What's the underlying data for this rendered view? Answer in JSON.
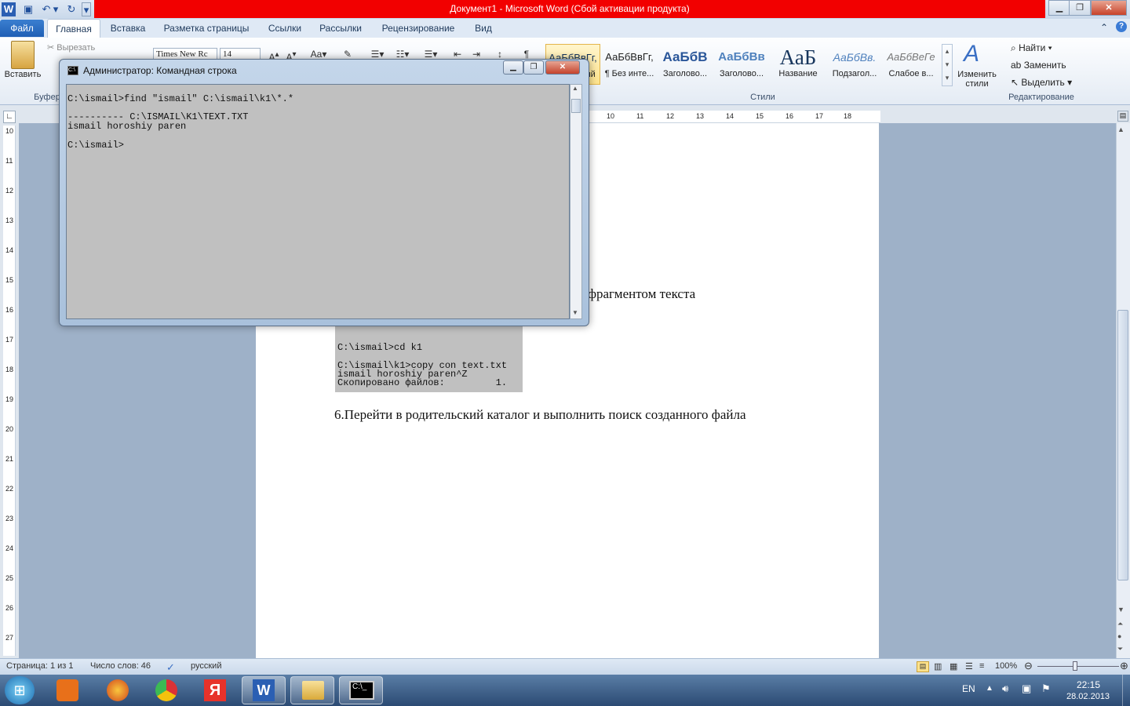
{
  "window": {
    "title": "Документ1  -  Microsoft Word (Сбой активации продукта)",
    "min": "▁",
    "max": "❐",
    "close": "✕"
  },
  "quick_access": {
    "word_icon": "W",
    "save": "▣",
    "undo": "↶",
    "undo_dd": "▾",
    "redo": "↻",
    "more": "▾"
  },
  "tabs": [
    "Файл",
    "Главная",
    "Вставка",
    "Разметка страницы",
    "Ссылки",
    "Рассылки",
    "Рецензирование",
    "Вид"
  ],
  "ribbon": {
    "paste": "Вставить",
    "cut": "Вырезать",
    "font_name": "Times New Rc",
    "font_size": "14",
    "groups": {
      "clipboard": "Буфер",
      "styles": "Стили",
      "editing": "Редактирование"
    },
    "styles": [
      {
        "sample": "АаБбВвГг,",
        "name": "¶ Обычный"
      },
      {
        "sample": "АаБбВвГг,",
        "name": "¶ Без инте..."
      },
      {
        "sample": "АаБбВ",
        "name": "Заголово..."
      },
      {
        "sample": "АаБбВв",
        "name": "Заголово..."
      },
      {
        "sample": "АаБ",
        "name": "Название"
      },
      {
        "sample": "АаБбВв.",
        "name": "Подзагол..."
      },
      {
        "sample": "АаБбВеГе",
        "name": "Слабое в..."
      }
    ],
    "change_styles": "Изменить стили",
    "find": "Найти",
    "replace": "Заменить",
    "select": "Выделить"
  },
  "ruler_marks": [
    "10",
    "11",
    "12",
    "13",
    "14",
    "15",
    "16",
    "17",
    "18"
  ],
  "vruler_marks": [
    "10",
    "11",
    "12",
    "13",
    "14",
    "15",
    "16",
    "17",
    "18",
    "19",
    "20",
    "21",
    "22",
    "23",
    "24",
    "25",
    "26",
    "27"
  ],
  "document": {
    "line_partial": "фрагментом текста",
    "embedded_lines": [
      "C:\\ismail>cd k1",
      "",
      "C:\\ismail\\k1>copy con text.txt",
      "ismail horoshiy paren^Z",
      "Скопировано файлов:         1."
    ],
    "para6": "6.Перейти в родительский каталог и выполнить поиск созданного файла"
  },
  "cmd": {
    "title": "Администратор: Командная строка",
    "lines": [
      "C:\\ismail>find \"ismail\" C:\\ismail\\k1\\*.*",
      "",
      "---------- C:\\ISMAIL\\K1\\TEXT.TXT",
      "ismail horoshiy paren",
      "",
      "C:\\ismail>"
    ]
  },
  "status": {
    "page": "Страница: 1 из 1",
    "words": "Число слов: 46",
    "lang": "русский",
    "zoom": "100%"
  },
  "taskbar": {
    "lang": "EN",
    "time": "22:15",
    "date": "28.02.2013",
    "start": "⊞"
  }
}
